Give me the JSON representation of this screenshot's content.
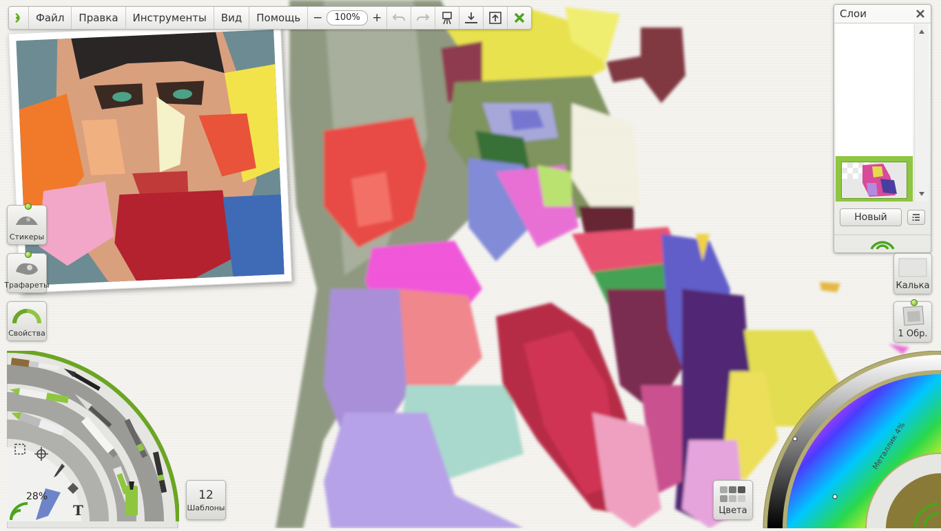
{
  "menu": {
    "items": [
      "Файл",
      "Правка",
      "Инструменты",
      "Вид",
      "Помощь"
    ],
    "zoom": "100%",
    "zoom_out": "−",
    "zoom_in": "+"
  },
  "left_panel": {
    "stickers": "Стикеры",
    "stencils": "Трафареты",
    "properties": "Свойства"
  },
  "tools": {
    "brush_size": "28%"
  },
  "templates": {
    "count": "12",
    "label": "Шаблоны"
  },
  "layers": {
    "title": "Слои",
    "new_button": "Новый"
  },
  "right_panel": {
    "tracing": "Калька",
    "references": "1 Обр."
  },
  "colors": {
    "label": "Цвета",
    "metallic": "Металлик 4%",
    "accent": "#8ec63f"
  }
}
